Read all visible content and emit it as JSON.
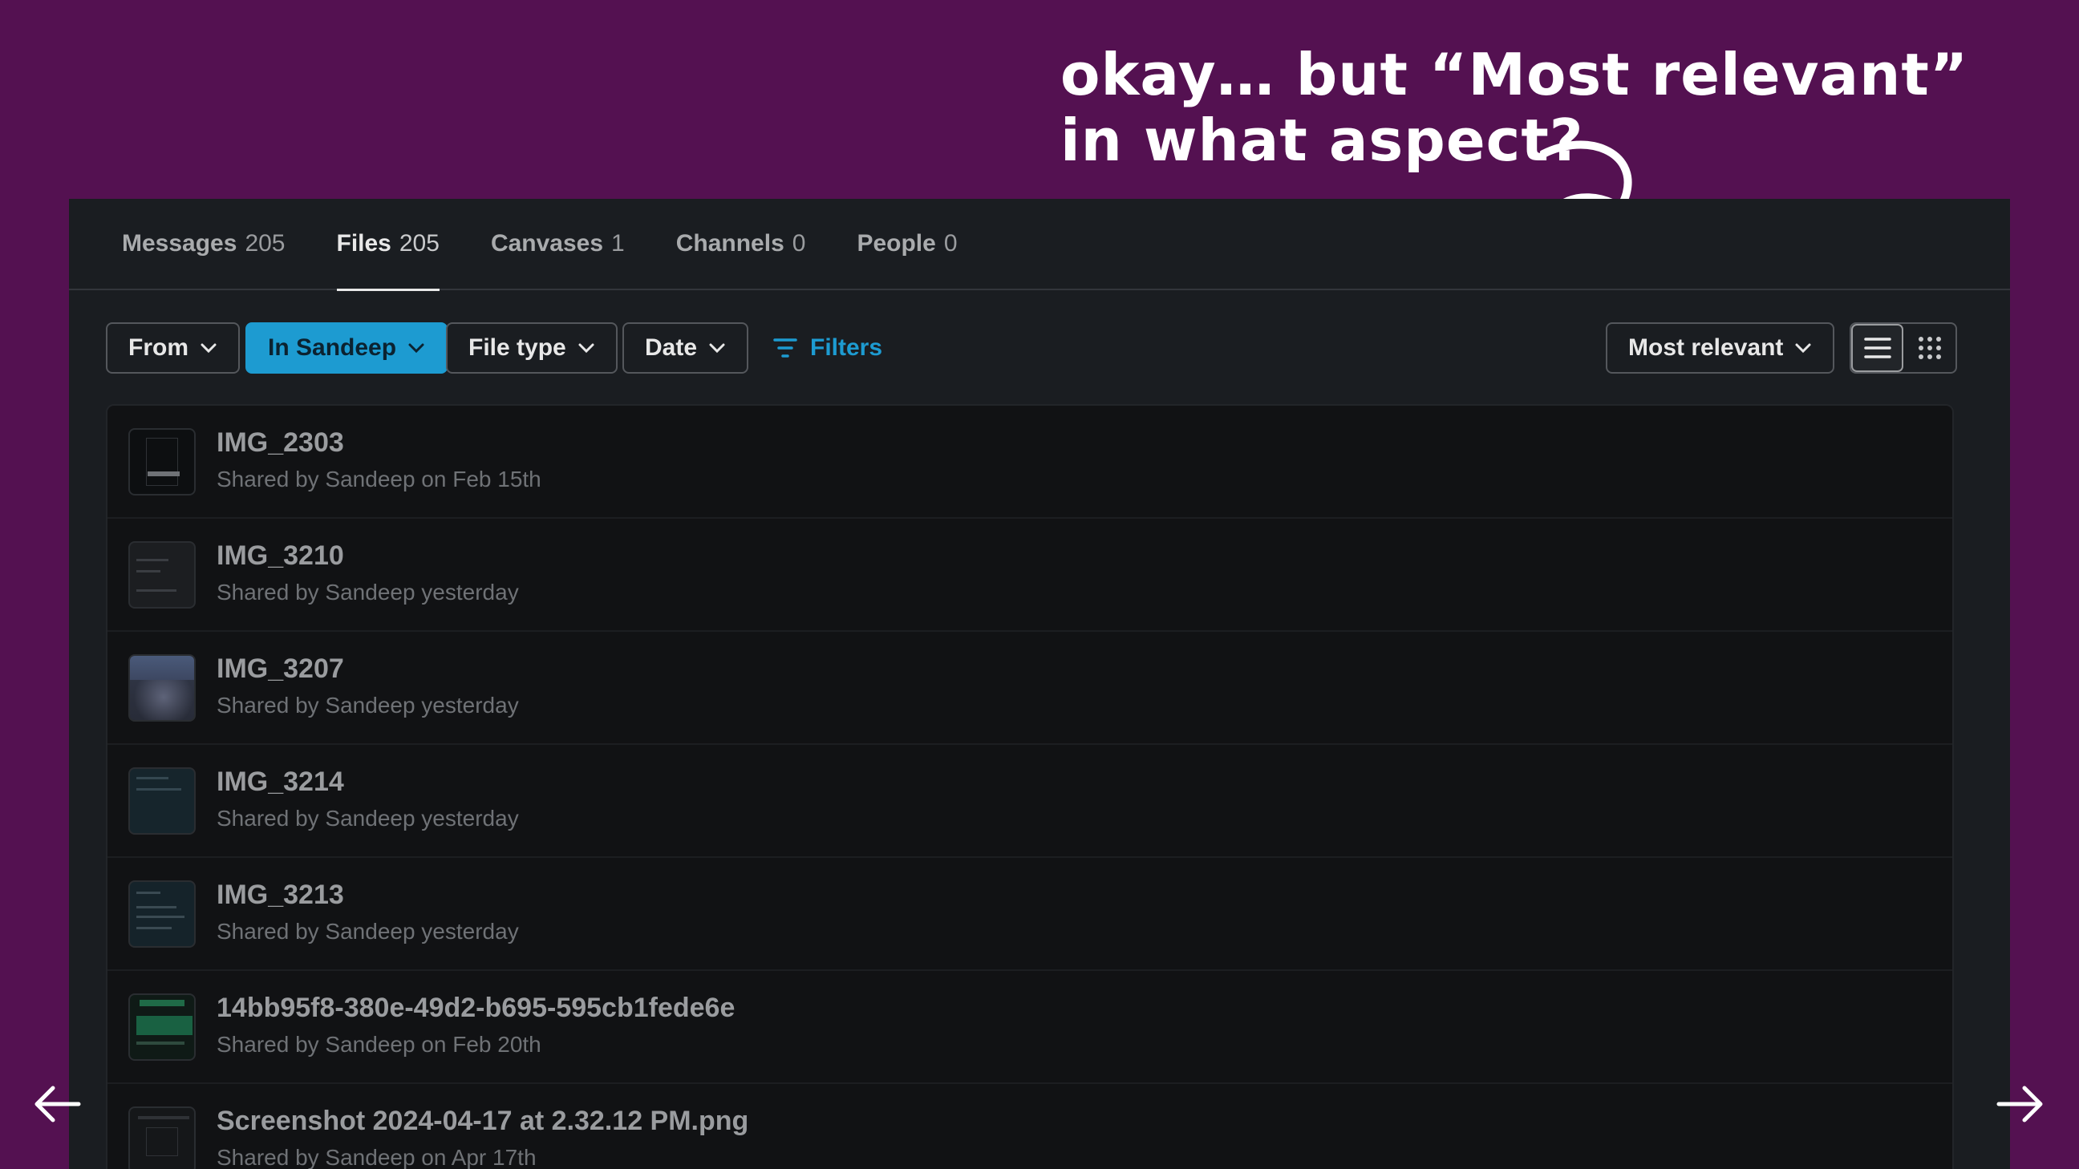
{
  "annotation": {
    "line1": "okay… but “Most relevant”",
    "line2": "in what aspect?"
  },
  "tabs": [
    {
      "label": "Messages",
      "count": "205"
    },
    {
      "label": "Files",
      "count": "205"
    },
    {
      "label": "Canvases",
      "count": "1"
    },
    {
      "label": "Channels",
      "count": "0"
    },
    {
      "label": "People",
      "count": "0"
    }
  ],
  "filters": {
    "from_label": "From",
    "in_label": "In Sandeep",
    "filetype_label": "File type",
    "date_label": "Date",
    "filters_label": "Filters",
    "sort_label": "Most relevant"
  },
  "files": [
    {
      "name": "IMG_2303",
      "meta": "Shared by Sandeep on Feb 15th"
    },
    {
      "name": "IMG_3210",
      "meta": "Shared by Sandeep yesterday"
    },
    {
      "name": "IMG_3207",
      "meta": "Shared by Sandeep yesterday"
    },
    {
      "name": "IMG_3214",
      "meta": "Shared by Sandeep yesterday"
    },
    {
      "name": "IMG_3213",
      "meta": "Shared by Sandeep yesterday"
    },
    {
      "name": "14bb95f8-380e-49d2-b695-595cb1fede6e",
      "meta": "Shared by Sandeep on Feb 20th"
    },
    {
      "name": "Screenshot 2024-04-17 at 2.32.12 PM.png",
      "meta": "Shared by Sandeep on Apr 17th"
    }
  ],
  "colors": {
    "background": "#541151",
    "panel": "#1a1d21",
    "accent": "#1d9bd1"
  },
  "icons": {
    "prev": "arrow-left-icon",
    "next": "arrow-right-icon",
    "filter": "filter-icon",
    "list_view": "list-view-icon",
    "grid_view": "grid-view-icon"
  }
}
